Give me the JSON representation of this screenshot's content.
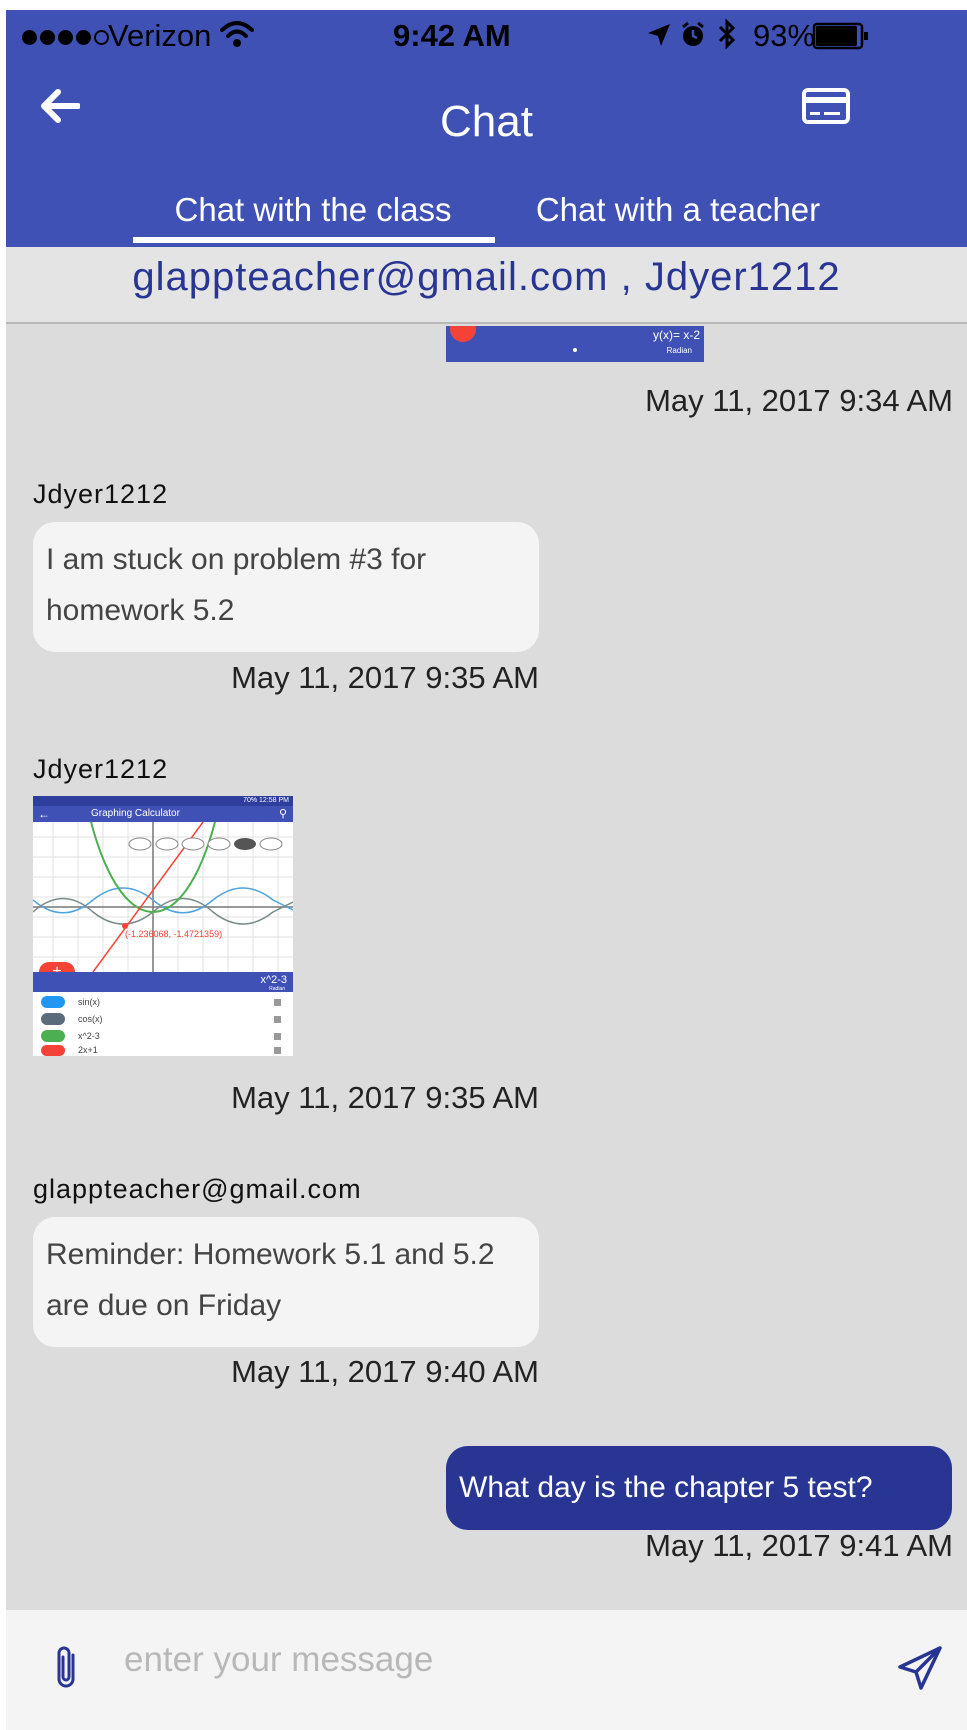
{
  "status_bar": {
    "carrier": "Verizon",
    "time": "9:42 AM",
    "battery": "93%",
    "signal_bars": 4,
    "battery_level": 0.93
  },
  "header": {
    "title": "Chat",
    "back_icon": "arrow-left-icon",
    "action_icon": "credit-card-icon"
  },
  "tabs": [
    {
      "label": "Chat with the class",
      "active": true
    },
    {
      "label": "Chat with a teacher",
      "active": false
    }
  ],
  "participants": "glappteacher@gmail.com , Jdyer1212",
  "image_labels": {
    "top_image": {
      "formula": "y(x)= x-2",
      "mode": "Radian"
    },
    "screenshot": {
      "app_title": "Graphing Calculator",
      "status_time": "70% 12:58 PM",
      "point_label": "(-1.236068, -1.4721359)",
      "input_text": "x^2-3",
      "mode": "Radian",
      "functions": [
        "sin(x)",
        "cos(x)",
        "x^2-3",
        "2x+1"
      ]
    }
  },
  "messages": [
    {
      "type": "image",
      "sender": "",
      "direction": "out",
      "time": "May 11, 2017 9:34 AM"
    },
    {
      "type": "text",
      "sender": "Jdyer1212",
      "direction": "in",
      "lines": [
        "I am stuck on problem #3 for",
        "homework 5.2"
      ],
      "time": "May 11, 2017 9:35 AM"
    },
    {
      "type": "image",
      "sender": "Jdyer1212",
      "direction": "in",
      "time": "May 11, 2017 9:35 AM"
    },
    {
      "type": "text",
      "sender": "glappteacher@gmail.com",
      "direction": "in",
      "lines": [
        "Reminder: Homework 5.1 and 5.2",
        "are due on Friday"
      ],
      "time": "May 11, 2017 9:40 AM"
    },
    {
      "type": "text",
      "sender": "",
      "direction": "out",
      "lines": [
        "What day is the chapter 5 test?"
      ],
      "time": "May 11, 2017 9:41 AM"
    }
  ],
  "composer": {
    "placeholder": "enter your message",
    "attach_icon": "paperclip-icon",
    "send_icon": "send-icon"
  },
  "colors": {
    "primary": "#3f51b5",
    "primary_dark": "#283593",
    "background": "#dcdcdc",
    "bubble_in": "#f4f4f4"
  }
}
